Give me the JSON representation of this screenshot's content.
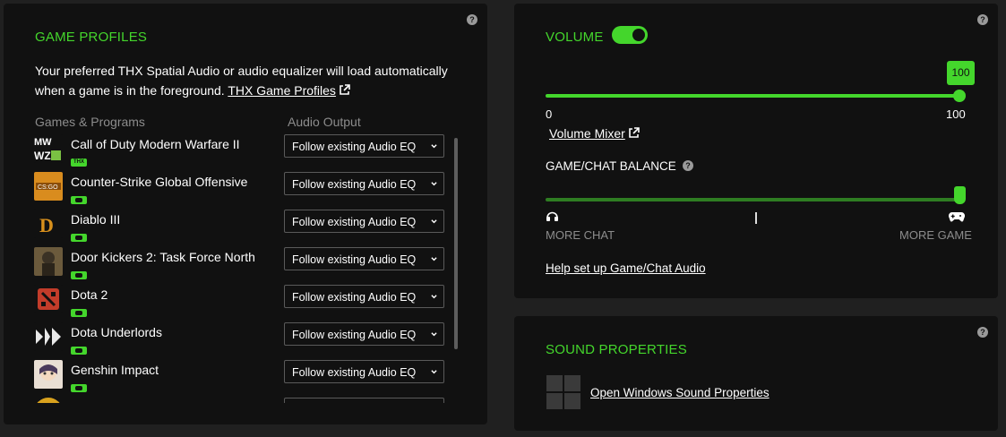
{
  "games_panel": {
    "title": "GAME PROFILES",
    "description": "Your preferred THX Spatial Audio or audio equalizer will load automatically when a game is in the foreground.",
    "link_label": "THX Game Profiles",
    "col_games": "Games & Programs",
    "col_output": "Audio Output",
    "games": [
      {
        "name": "Call of Duty Modern Warfare II",
        "output": "Follow existing Audio EQ",
        "badge": "THX",
        "icon": "cod-mw2-icon"
      },
      {
        "name": "Counter-Strike Global Offensive",
        "output": "Follow existing Audio EQ",
        "badge": "game",
        "icon": "csgo-icon"
      },
      {
        "name": "Diablo III",
        "output": "Follow existing Audio EQ",
        "badge": "game",
        "icon": "diablo-icon"
      },
      {
        "name": "Door Kickers 2: Task Force North",
        "output": "Follow existing Audio EQ",
        "badge": "game",
        "icon": "door-kickers-icon"
      },
      {
        "name": "Dota 2",
        "output": "Follow existing Audio EQ",
        "badge": "game",
        "icon": "dota2-icon"
      },
      {
        "name": "Dota Underlords",
        "output": "Follow existing Audio EQ",
        "badge": "game",
        "icon": "dota-underlords-icon"
      },
      {
        "name": "Genshin Impact",
        "output": "Follow existing Audio EQ",
        "badge": "game",
        "icon": "genshin-icon"
      }
    ]
  },
  "volume_panel": {
    "title": "VOLUME",
    "toggle_on": true,
    "volume_value": "100",
    "min_label": "0",
    "max_label": "100",
    "volume_level": 1.0,
    "mixer_link": "Volume Mixer",
    "balance_title": "GAME/CHAT BALANCE",
    "balance_level": 1.0,
    "more_chat": "MORE CHAT",
    "more_game": "MORE GAME",
    "help_link": "Help set up Game/Chat Audio"
  },
  "sound_panel": {
    "title": "SOUND PROPERTIES",
    "link": "Open Windows Sound Properties"
  },
  "colors": {
    "accent": "#44d62c",
    "panel_bg": "#111111",
    "page_bg": "#202020"
  }
}
